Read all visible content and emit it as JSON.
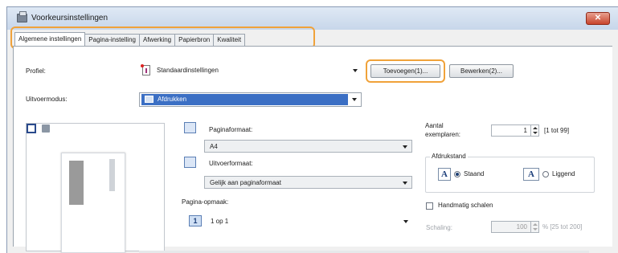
{
  "window": {
    "title": "Voorkeursinstellingen",
    "close_glyph": "✕"
  },
  "tabs": [
    {
      "label": "Algemene instellingen",
      "active": true
    },
    {
      "label": "Pagina-instelling",
      "active": false
    },
    {
      "label": "Afwerking",
      "active": false
    },
    {
      "label": "Papierbron",
      "active": false
    },
    {
      "label": "Kwaliteit",
      "active": false
    }
  ],
  "profile": {
    "label": "Profiel:",
    "value": "Standaardinstellingen",
    "add_button": "Toevoegen(1)...",
    "edit_button": "Bewerken(2)..."
  },
  "output_mode": {
    "label": "Uitvoermodus:",
    "value": "Afdrukken"
  },
  "page_size": {
    "label": "Paginaformaat:",
    "value": "A4"
  },
  "output_size": {
    "label": "Uitvoerformaat:",
    "value": "Gelijk aan paginaformaat"
  },
  "copies": {
    "label_line1": "Aantal",
    "label_line2": "exemplaren:",
    "value": "1",
    "range": "[1 tot 99]"
  },
  "orientation": {
    "group_label": "Afdrukstand",
    "portrait": "Staand",
    "landscape": "Liggend",
    "icon_letter": "A",
    "selected": "portrait"
  },
  "page_layout": {
    "label": "Pagina-opmaak:",
    "number": "1",
    "value": "1 op 1"
  },
  "manual_scaling": {
    "label": "Handmatig schalen",
    "checked": false
  },
  "scaling": {
    "label": "Schaling:",
    "value": "100",
    "range": "% [25 tot 200]"
  },
  "accent_color": "#f0a23a",
  "icons": [
    "printer-icon",
    "profile-icon",
    "page-size-icon",
    "output-size-icon",
    "orientation-portrait-icon",
    "orientation-landscape-icon",
    "close-icon"
  ]
}
